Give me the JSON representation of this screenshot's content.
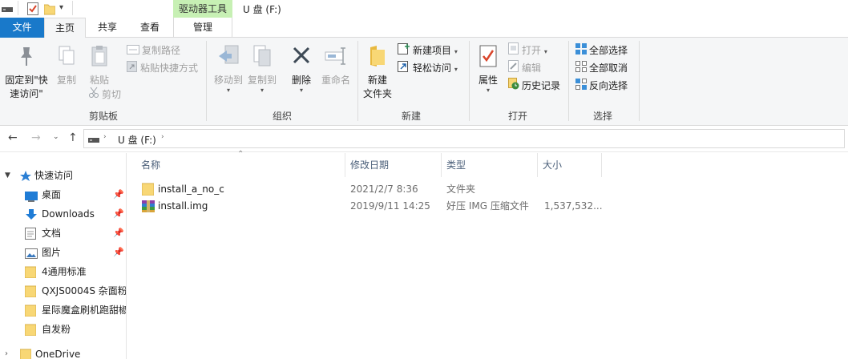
{
  "window": {
    "title": "U 盘 (F:)",
    "contextual_tab_header": "驱动器工具"
  },
  "tabs": {
    "file": "文件",
    "home": "主页",
    "share": "共享",
    "view": "查看",
    "manage": "管理"
  },
  "ribbon": {
    "clipboard": {
      "group_label": "剪贴板",
      "pin_quick_access": "固定到\"快\n速访问\"",
      "copy": "复制",
      "paste": "粘贴",
      "copy_path": "复制路径",
      "paste_shortcut": "粘贴快捷方式",
      "cut": "剪切"
    },
    "organize": {
      "group_label": "组织",
      "move_to": "移动到",
      "copy_to": "复制到",
      "delete": "删除",
      "rename": "重命名"
    },
    "new": {
      "group_label": "新建",
      "new_folder": "新建\n文件夹",
      "new_item": "新建项目",
      "easy_access": "轻松访问"
    },
    "open": {
      "group_label": "打开",
      "properties": "属性",
      "open": "打开",
      "edit": "编辑",
      "history": "历史记录"
    },
    "select": {
      "group_label": "选择",
      "select_all": "全部选择",
      "select_none": "全部取消",
      "invert_selection": "反向选择"
    }
  },
  "address": {
    "path_label": "U 盘 (F:)"
  },
  "navpane": {
    "quick_access": "快速访问",
    "items": [
      {
        "label": "桌面",
        "pinned": true
      },
      {
        "label": "Downloads",
        "pinned": true
      },
      {
        "label": "文档",
        "pinned": true
      },
      {
        "label": "图片",
        "pinned": true
      },
      {
        "label": "4通用标准",
        "pinned": false
      },
      {
        "label": "QXJS0004S 杂面粉",
        "pinned": false
      },
      {
        "label": "星际魔盒刷机跑甜椒",
        "pinned": false
      },
      {
        "label": "自发粉",
        "pinned": false
      }
    ],
    "onedrive": "OneDrive"
  },
  "filelist": {
    "columns": {
      "name": "名称",
      "modified": "修改日期",
      "type": "类型",
      "size": "大小"
    },
    "rows": [
      {
        "name": "install_a_no_c",
        "modified": "2021/2/7 8:36",
        "type": "文件夹",
        "size": "",
        "icon": "folder-icon"
      },
      {
        "name": "install.img",
        "modified": "2019/9/11 14:25",
        "type": "好压 IMG 压缩文件",
        "size": "1,537,532...",
        "icon": "archive-icon"
      }
    ]
  },
  "colors": {
    "file_tab": "#1979ca",
    "contextual_header": "#c7f0b4",
    "folder": "#f8d775",
    "ribbon_bg": "#f5f6f7"
  }
}
